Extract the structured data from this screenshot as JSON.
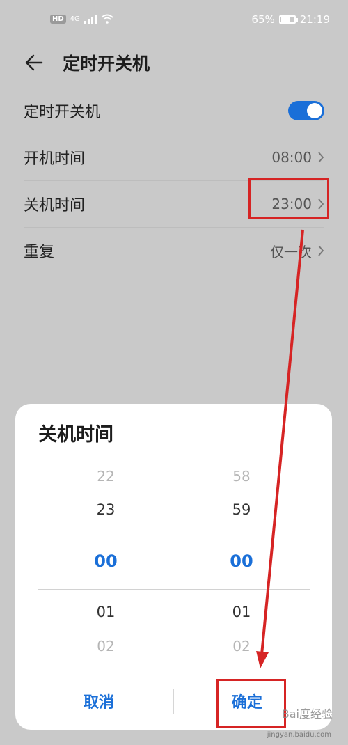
{
  "status_bar": {
    "hd_badge": "HD",
    "network": "4G",
    "battery": "65%",
    "battery_level": 0.65,
    "time": "21:19"
  },
  "header": {
    "title": "定时开关机"
  },
  "settings": {
    "auto_power_label": "定时开关机",
    "auto_power_on": true,
    "power_on_label": "开机时间",
    "power_on_time": "08:00",
    "power_off_label": "关机时间",
    "power_off_time": "23:00",
    "repeat_label": "重复",
    "repeat_value": "仅一次"
  },
  "dialog": {
    "title": "关机时间",
    "hours": [
      "22",
      "23",
      "00",
      "01",
      "02"
    ],
    "minutes": [
      "58",
      "59",
      "00",
      "01",
      "02"
    ],
    "selected_hour": "00",
    "selected_minute": "00",
    "cancel_label": "取消",
    "confirm_label": "确定"
  },
  "colors": {
    "accent": "#1a6fd8",
    "annotation": "#d62424",
    "background": "#c9c9c9"
  },
  "watermark": {
    "text": "Bai度经验",
    "url": "jingyan.baidu.com"
  }
}
